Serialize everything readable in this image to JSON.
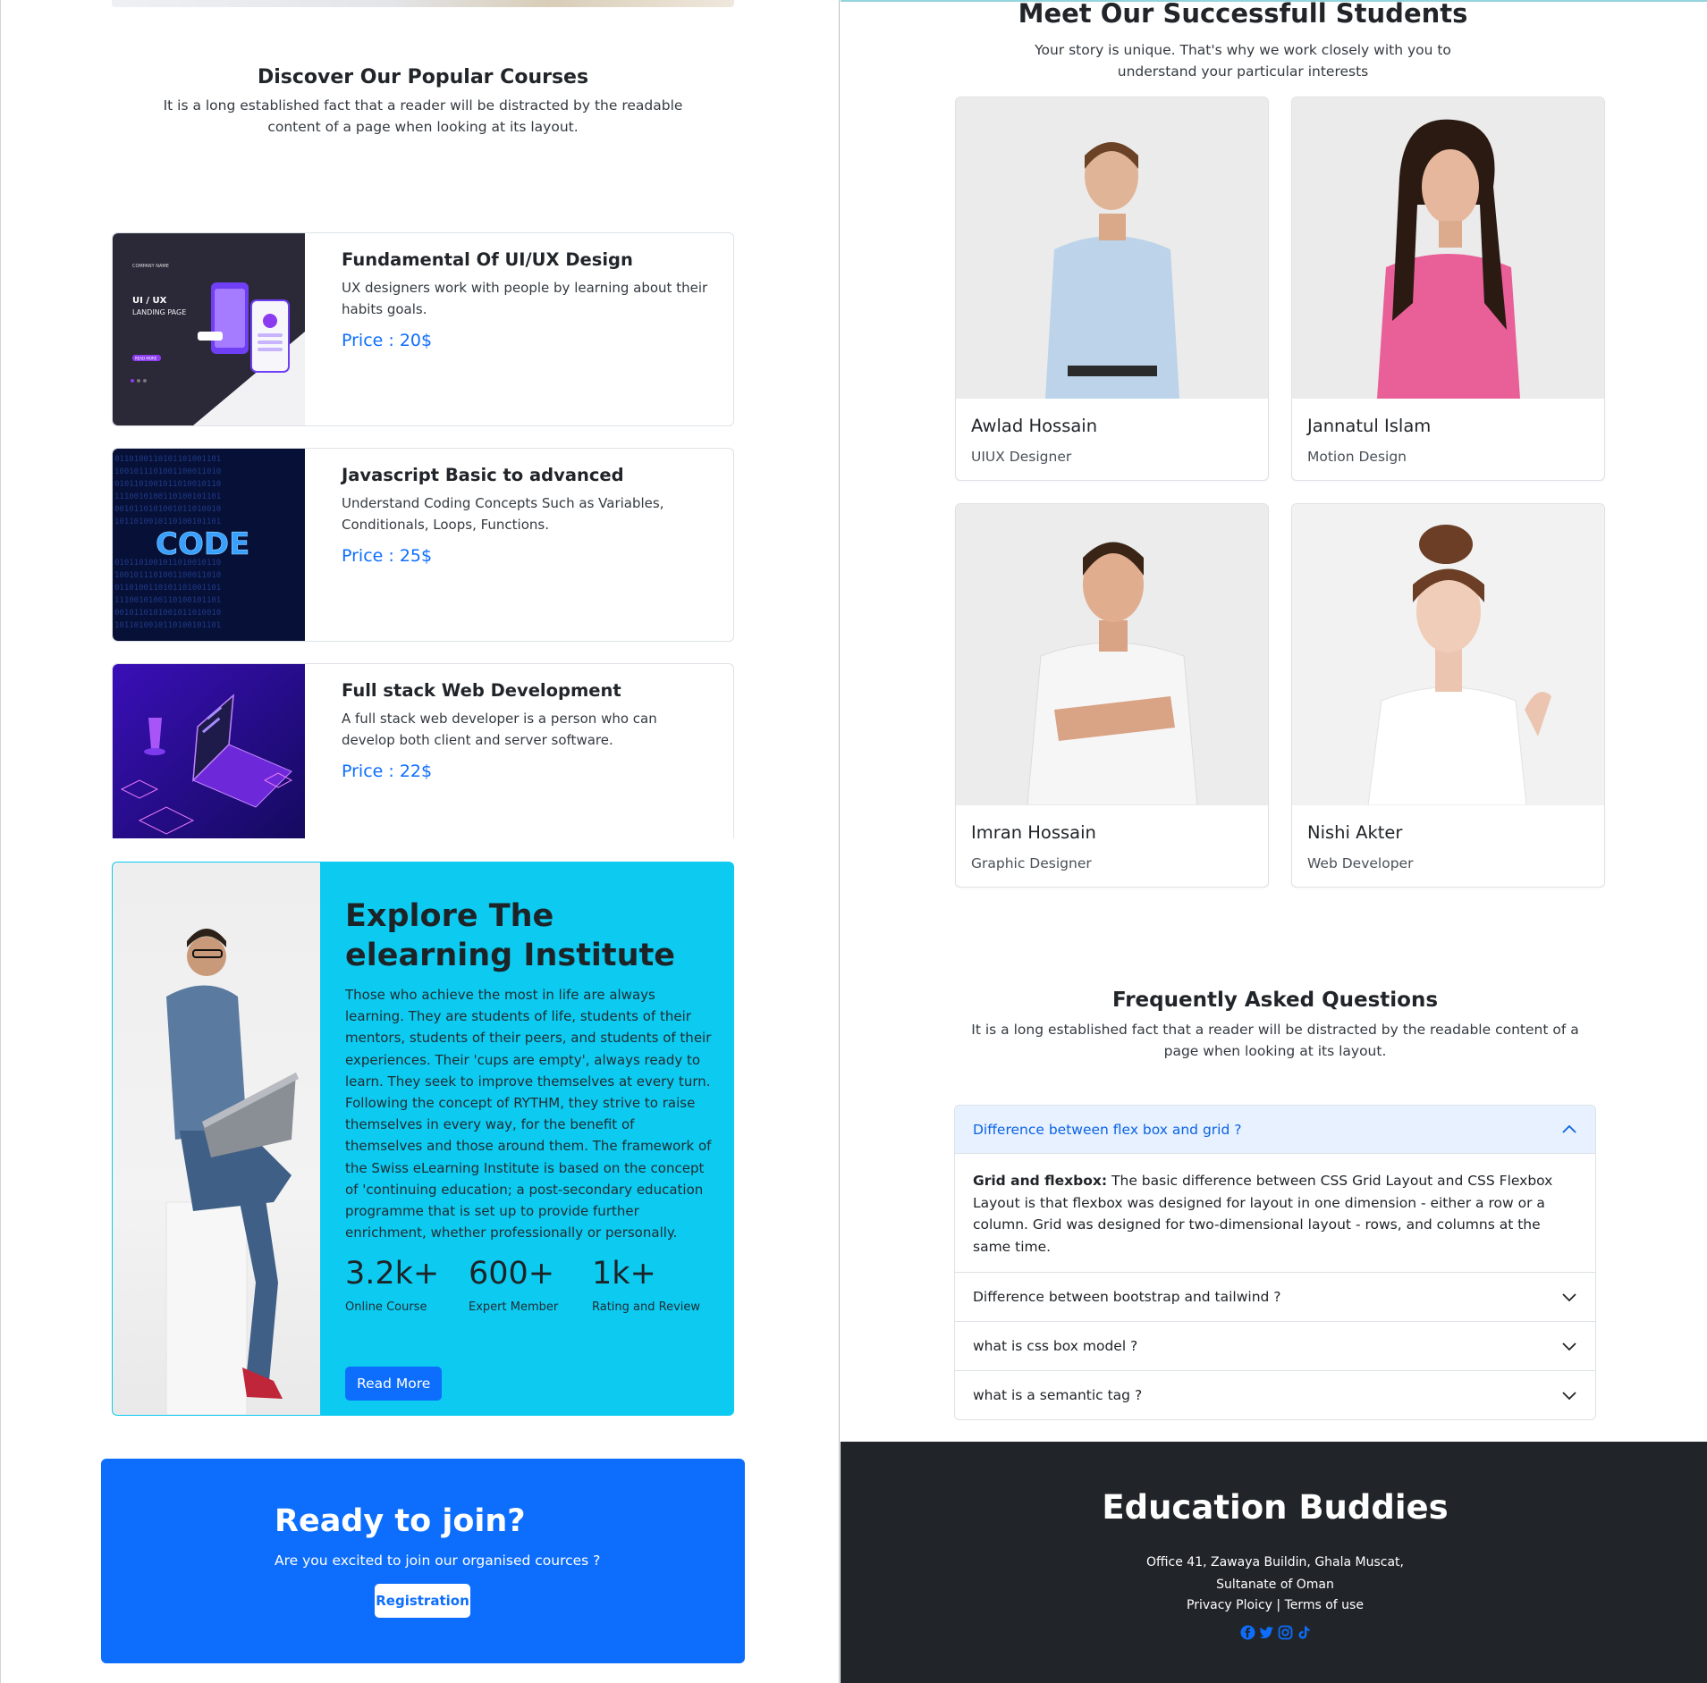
{
  "courses_section": {
    "title": "Discover Our Popular Courses",
    "subtitle": "It is a long established fact that a reader will be distracted by the readable content of a page when looking at its layout."
  },
  "courses": [
    {
      "title": "Fundamental Of UI/UX Design",
      "description": "UX designers work with people by learning about their habits goals.",
      "price": "Price : 20$",
      "thumb_text": {
        "company": "COMPANY NAME",
        "heading": "UI / UX",
        "sub": "LANDING PAGE",
        "button": "READ MORE"
      }
    },
    {
      "title": "Javascript Basic to advanced",
      "description": "Understand Coding Concepts Such as Variables, Conditionals, Loops, Functions.",
      "price": "Price : 25$",
      "thumb_text": {
        "word": "CODE"
      }
    },
    {
      "title": "Full stack Web Development",
      "description": "A full stack web developer is a person who can develop both client and server software.",
      "price": "Price : 22$"
    }
  ],
  "explore": {
    "title": "Explore The elearning Institute",
    "text": "Those who achieve the most in life are always learning. They are students of life, students of their mentors, students of their peers, and students of their experiences. Their 'cups are empty', always ready to learn. They seek to improve themselves at every turn. Following the concept of RYTHM, they strive to raise themselves in every way, for the benefit of themselves and those around them. The framework of the Swiss eLearning Institute is based on the concept of 'continuing education; a post-secondary education programme that is set up to provide further enrichment, whether professionally or personally.",
    "stats": [
      {
        "value": "3.2k+",
        "label": "Online Course"
      },
      {
        "value": "600+",
        "label": "Expert Member"
      },
      {
        "value": "1k+",
        "label": "Rating and Review"
      }
    ],
    "button": "Read More"
  },
  "join": {
    "title": "Ready to join?",
    "subtitle": "Are you excited to join our organised cources ?",
    "button": "Registration"
  },
  "students_section": {
    "title": "Meet Our Successfull Students",
    "subtitle_line1": "Your story is unique. That's why we work closely with you to",
    "subtitle_line2": "understand your particular interests"
  },
  "students": [
    {
      "name": "Awlad Hossain",
      "role": "UIUX Designer"
    },
    {
      "name": "Jannatul Islam",
      "role": "Motion Design"
    },
    {
      "name": "Imran Hossain",
      "role": "Graphic Designer"
    },
    {
      "name": "Nishi Akter",
      "role": "Web Developer"
    }
  ],
  "faq": {
    "title": "Frequently Asked Questions",
    "subtitle": "It is a long established fact that a reader will be distracted by the readable content of a page when looking at its layout.",
    "items": [
      {
        "question": "Difference between flex box and grid ?",
        "answer_bold": "Grid and flexbox:",
        "answer": " The basic difference between CSS Grid Layout and CSS Flexbox Layout is that flexbox was designed for layout in one dimension - either a row or a column. Grid was designed for two-dimensional layout - rows, and columns at the same time.",
        "expanded": true
      },
      {
        "question": "Difference between bootstrap and tailwind ?",
        "expanded": false
      },
      {
        "question": "what is css box model ?",
        "expanded": false
      },
      {
        "question": "what is a semantic tag ?",
        "expanded": false
      }
    ]
  },
  "footer": {
    "title": "Education Buddies",
    "address_line1": "Office 41, Zawaya Buildin, Ghala Muscat,",
    "address_line2": "Sultanate of Oman",
    "privacy": "Privacy Ploicy",
    "separator": "|",
    "terms": "Terms of use",
    "social_icons": [
      "facebook-icon",
      "twitter-icon",
      "instagram-icon",
      "tiktok-icon"
    ]
  },
  "colors": {
    "primary": "#0d6efd",
    "info": "#0dcaf0",
    "dark": "#212529",
    "accordion_active": "#e7f1ff"
  }
}
